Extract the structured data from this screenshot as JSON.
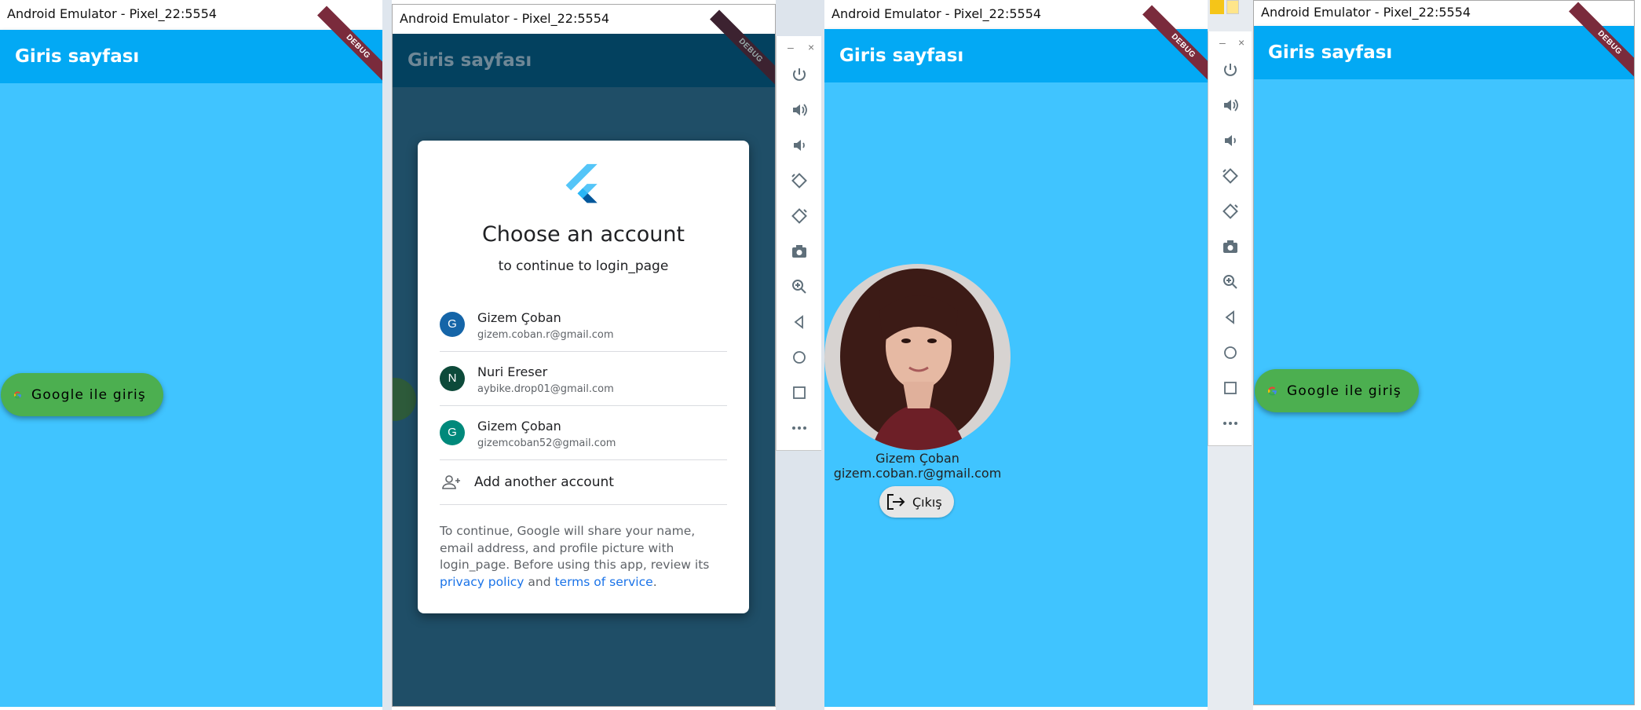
{
  "colors": {
    "appbar": "#03A9F4",
    "background": "#40C4FF",
    "google_button": "#4CAF50",
    "scrim": "#1f4e67",
    "link": "#1a73e8"
  },
  "windows": [
    {
      "title": "Android Emulator - Pixel_22:5554",
      "appbar_title": "Giris sayfası",
      "debug": "DEBUG",
      "button_label": "Google ile giriş"
    },
    {
      "title": "Android Emulator - Pixel_22:5554",
      "appbar_title": "Giris sayfası",
      "debug": "DEBUG"
    },
    {
      "title": "Android Emulator - Pixel_22:5554",
      "appbar_title": "Giris sayfası",
      "debug": "DEBUG"
    },
    {
      "title": "Android Emulator - Pixel_22:5554",
      "appbar_title": "Giris sayfası",
      "debug": "DEBUG",
      "button_label": "Google ile giriş"
    }
  ],
  "account_chooser": {
    "title": "Choose an account",
    "subtitle": "to continue to login_page",
    "accounts": [
      {
        "initial": "G",
        "name": "Gizem Çoban",
        "email": "gizem.coban.r@gmail.com",
        "color": "#1565a8"
      },
      {
        "initial": "N",
        "name": "Nuri Ereser",
        "email": "aybike.drop01@gmail.com",
        "color": "#0d4a3a"
      },
      {
        "initial": "G",
        "name": "Gizem Çoban",
        "email": "gizemcoban52@gmail.com",
        "color": "#00897b"
      }
    ],
    "add_account": "Add another account",
    "notice_prefix": "To continue, Google will share your name, email address, and profile picture with login_page. Before using this app, review its ",
    "privacy_link": "privacy policy",
    "notice_and": " and ",
    "terms_link": "terms of service",
    "notice_end": "."
  },
  "profile": {
    "name": "Gizem Çoban",
    "email": "gizem.coban.r@gmail.com",
    "logout_label": "Çıkış"
  },
  "toolbar_icons": [
    "power-icon",
    "volume-up-icon",
    "volume-down-icon",
    "rotate-left-icon",
    "rotate-right-icon",
    "camera-icon",
    "zoom-icon",
    "back-icon",
    "home-icon",
    "overview-icon",
    "more-icon"
  ]
}
